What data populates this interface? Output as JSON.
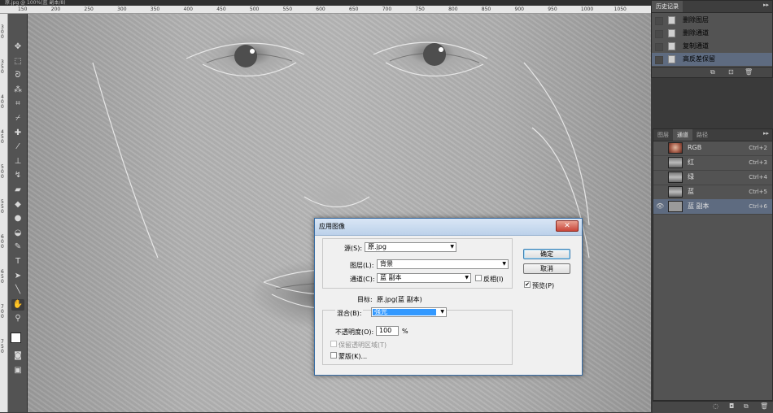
{
  "document_tab": "原.jpg @ 100%(蓝 副本/8)",
  "ruler_top": [
    "150",
    "200",
    "250",
    "300",
    "350",
    "400",
    "450",
    "500",
    "550",
    "600",
    "650",
    "700",
    "750",
    "800",
    "850",
    "900",
    "950",
    "1000",
    "1050"
  ],
  "ruler_left": [
    "300",
    "350",
    "400",
    "450",
    "500",
    "550",
    "600",
    "650",
    "700",
    "750"
  ],
  "tools": [
    {
      "icon": "move-tool-icon",
      "glyph": "✥"
    },
    {
      "icon": "marquee-tool-icon",
      "glyph": "⬚"
    },
    {
      "icon": "lasso-tool-icon",
      "glyph": "ᘐ"
    },
    {
      "icon": "magic-wand-icon",
      "glyph": "⁂"
    },
    {
      "icon": "crop-tool-icon",
      "glyph": "⌗"
    },
    {
      "icon": "eyedropper-icon",
      "glyph": "⌿"
    },
    {
      "icon": "healing-brush-icon",
      "glyph": "✚"
    },
    {
      "icon": "brush-tool-icon",
      "glyph": "⁄"
    },
    {
      "icon": "stamp-tool-icon",
      "glyph": "⊥"
    },
    {
      "icon": "history-brush-icon",
      "glyph": "↯"
    },
    {
      "icon": "eraser-icon",
      "glyph": "▰"
    },
    {
      "icon": "paint-bucket-icon",
      "glyph": "◆"
    },
    {
      "icon": "blur-tool-icon",
      "glyph": "●"
    },
    {
      "icon": "dodge-tool-icon",
      "glyph": "◒"
    },
    {
      "icon": "pen-tool-icon",
      "glyph": "✎"
    },
    {
      "icon": "type-tool-icon",
      "glyph": "T"
    },
    {
      "icon": "path-select-icon",
      "glyph": "➤"
    },
    {
      "icon": "line-tool-icon",
      "glyph": "╲"
    },
    {
      "icon": "hand-tool-icon",
      "glyph": "✋"
    },
    {
      "icon": "zoom-tool-icon",
      "glyph": "⚲"
    }
  ],
  "history_panel": {
    "title": "历史记录",
    "items": [
      "删除图层",
      "删除通道",
      "复制通道",
      "高反差保留"
    ],
    "selected_index": 3
  },
  "channels_panel": {
    "tabs": [
      "图层",
      "通道",
      "路径"
    ],
    "active_tab": 1,
    "items": [
      {
        "name": "RGB",
        "key": "Ctrl+2",
        "visible": false,
        "thumb": "rgb"
      },
      {
        "name": "红",
        "key": "Ctrl+3",
        "visible": false,
        "thumb": "gray"
      },
      {
        "name": "绿",
        "key": "Ctrl+4",
        "visible": false,
        "thumb": "gray"
      },
      {
        "name": "蓝",
        "key": "Ctrl+5",
        "visible": false,
        "thumb": "gray"
      },
      {
        "name": "蓝 副本",
        "key": "Ctrl+6",
        "visible": true,
        "thumb": "flat"
      }
    ]
  },
  "dialog": {
    "title": "应用图像",
    "close_glyph": "✕",
    "source_label": "源(S):",
    "source_value": "原.jpg",
    "layer_label": "图层(L):",
    "layer_value": "背景",
    "channel_label": "通道(C):",
    "channel_value": "蓝 副本",
    "invert_label": "反相(I)",
    "target_label": "目标:",
    "target_value": "原.jpg(蓝 副本)",
    "blend_label": "混合(B):",
    "blend_value": "强光",
    "opacity_label": "不透明度(O):",
    "opacity_value": "100",
    "opacity_unit": "%",
    "preserve_label": "保留透明区域(T)",
    "mask_label": "蒙版(K)...",
    "ok_label": "确定",
    "cancel_label": "取消",
    "preview_label": "预览(P)",
    "preview_checked": true
  },
  "colors": {
    "accent": "#3399ff",
    "selection": "#5e6b80",
    "panel": "#535353"
  }
}
